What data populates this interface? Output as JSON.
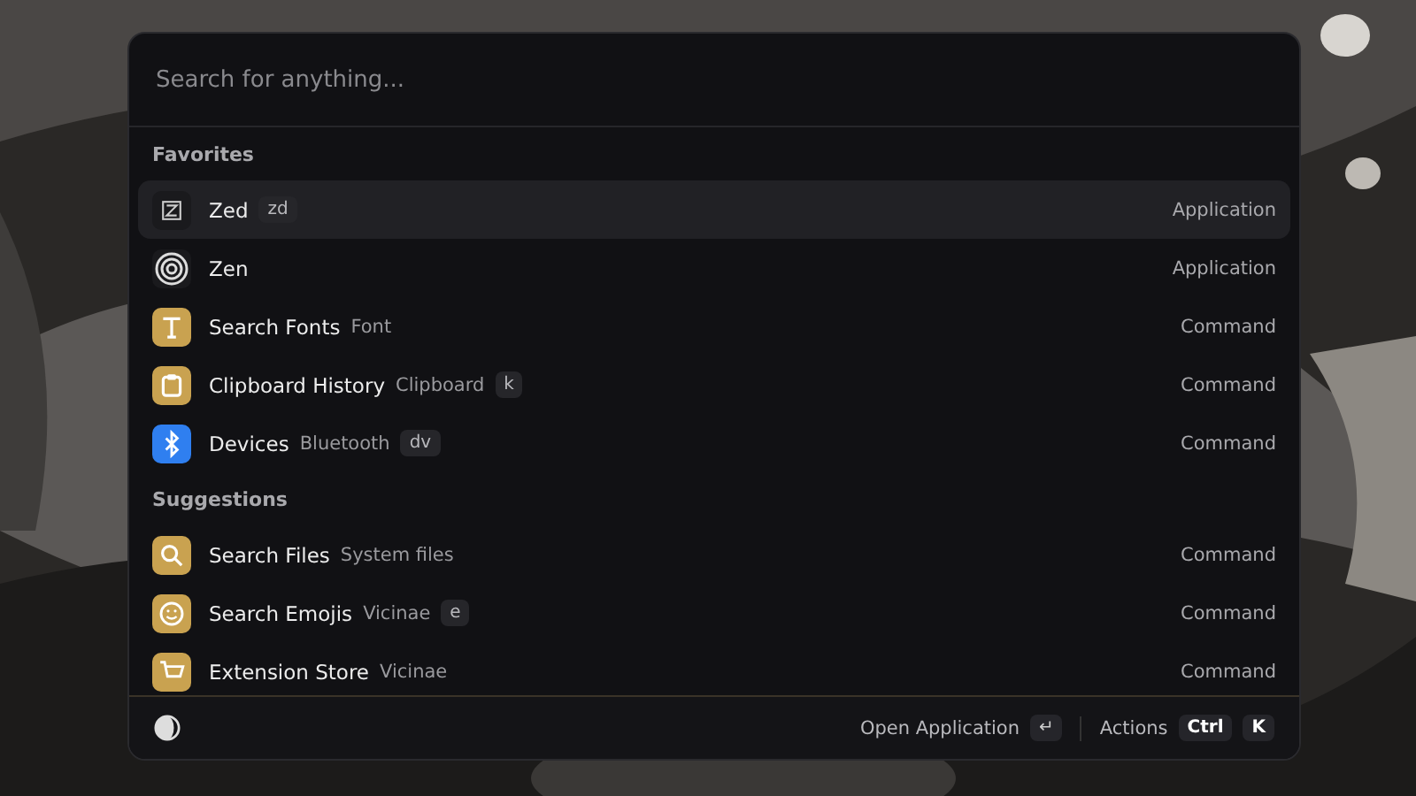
{
  "search": {
    "placeholder": "Search for anything..."
  },
  "sections": [
    {
      "title": "Favorites",
      "items": [
        {
          "kind": "zed",
          "title": "Zed",
          "alias": "zd",
          "type": "Application",
          "selected": true
        },
        {
          "kind": "zen",
          "title": "Zen",
          "type": "Application",
          "selected": false
        },
        {
          "kind": "font",
          "title": "Search Fonts",
          "subtitle": "Font",
          "type": "Command",
          "selected": false
        },
        {
          "kind": "clipboard",
          "title": "Clipboard History",
          "subtitle": "Clipboard",
          "alias": "k",
          "type": "Command",
          "selected": false
        },
        {
          "kind": "bluetooth",
          "title": "Devices",
          "subtitle": "Bluetooth",
          "alias": "dv",
          "type": "Command",
          "selected": false
        }
      ]
    },
    {
      "title": "Suggestions",
      "items": [
        {
          "kind": "search",
          "title": "Search Files",
          "subtitle": "System files",
          "type": "Command",
          "selected": false
        },
        {
          "kind": "emoji",
          "title": "Search Emojis",
          "subtitle": "Vicinae",
          "alias": "e",
          "type": "Command",
          "selected": false
        },
        {
          "kind": "store",
          "title": "Extension Store",
          "subtitle": "Vicinae",
          "type": "Command",
          "selected": false
        }
      ]
    }
  ],
  "footer": {
    "primary_action": "Open Application",
    "primary_key": "↵",
    "actions_label": "Actions",
    "action_keys": [
      "Ctrl",
      "K"
    ]
  }
}
